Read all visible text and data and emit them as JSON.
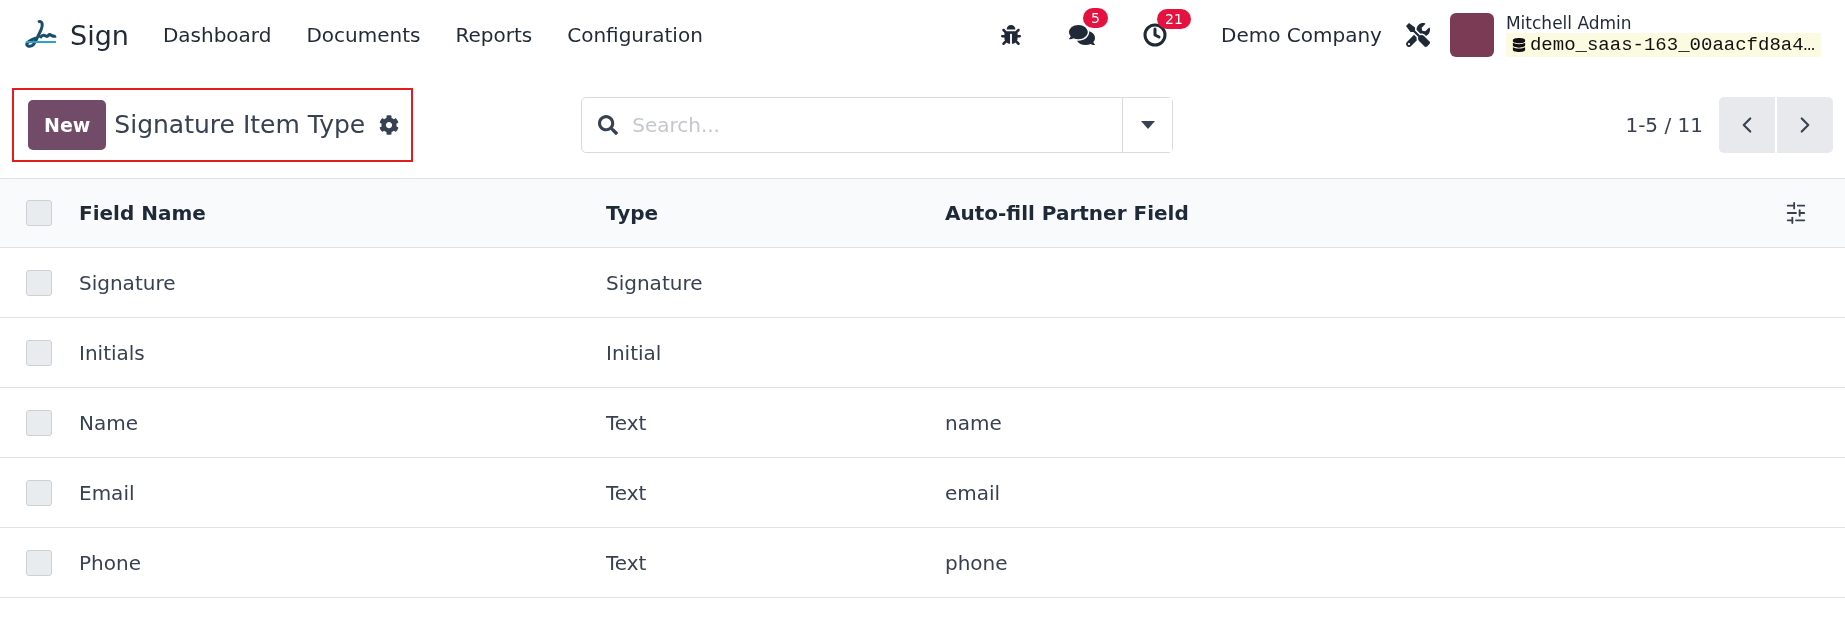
{
  "navbar": {
    "app_name": "Sign",
    "menu": [
      "Dashboard",
      "Documents",
      "Reports",
      "Configuration"
    ],
    "messages_count": "5",
    "activities_count": "21",
    "company": "Demo Company",
    "user": {
      "name": "Mitchell Admin",
      "database": "demo_saas-163_00aacfd8a4…"
    }
  },
  "control_panel": {
    "new_button": "New",
    "title": "Signature Item Type",
    "search": {
      "placeholder": "Search..."
    },
    "pager": "1-5 / 11",
    "highlighted": true
  },
  "table": {
    "select_all_checked": false,
    "columns": [
      "Field Name",
      "Type",
      "Auto-fill Partner Field"
    ],
    "rows": [
      {
        "cells": [
          "Signature",
          "Signature",
          ""
        ],
        "checked": false
      },
      {
        "cells": [
          "Initials",
          "Initial",
          ""
        ],
        "checked": false
      },
      {
        "cells": [
          "Name",
          "Text",
          "name"
        ],
        "checked": false
      },
      {
        "cells": [
          "Email",
          "Text",
          "email"
        ],
        "checked": false
      },
      {
        "cells": [
          "Phone",
          "Text",
          "phone"
        ],
        "checked": false
      }
    ]
  }
}
